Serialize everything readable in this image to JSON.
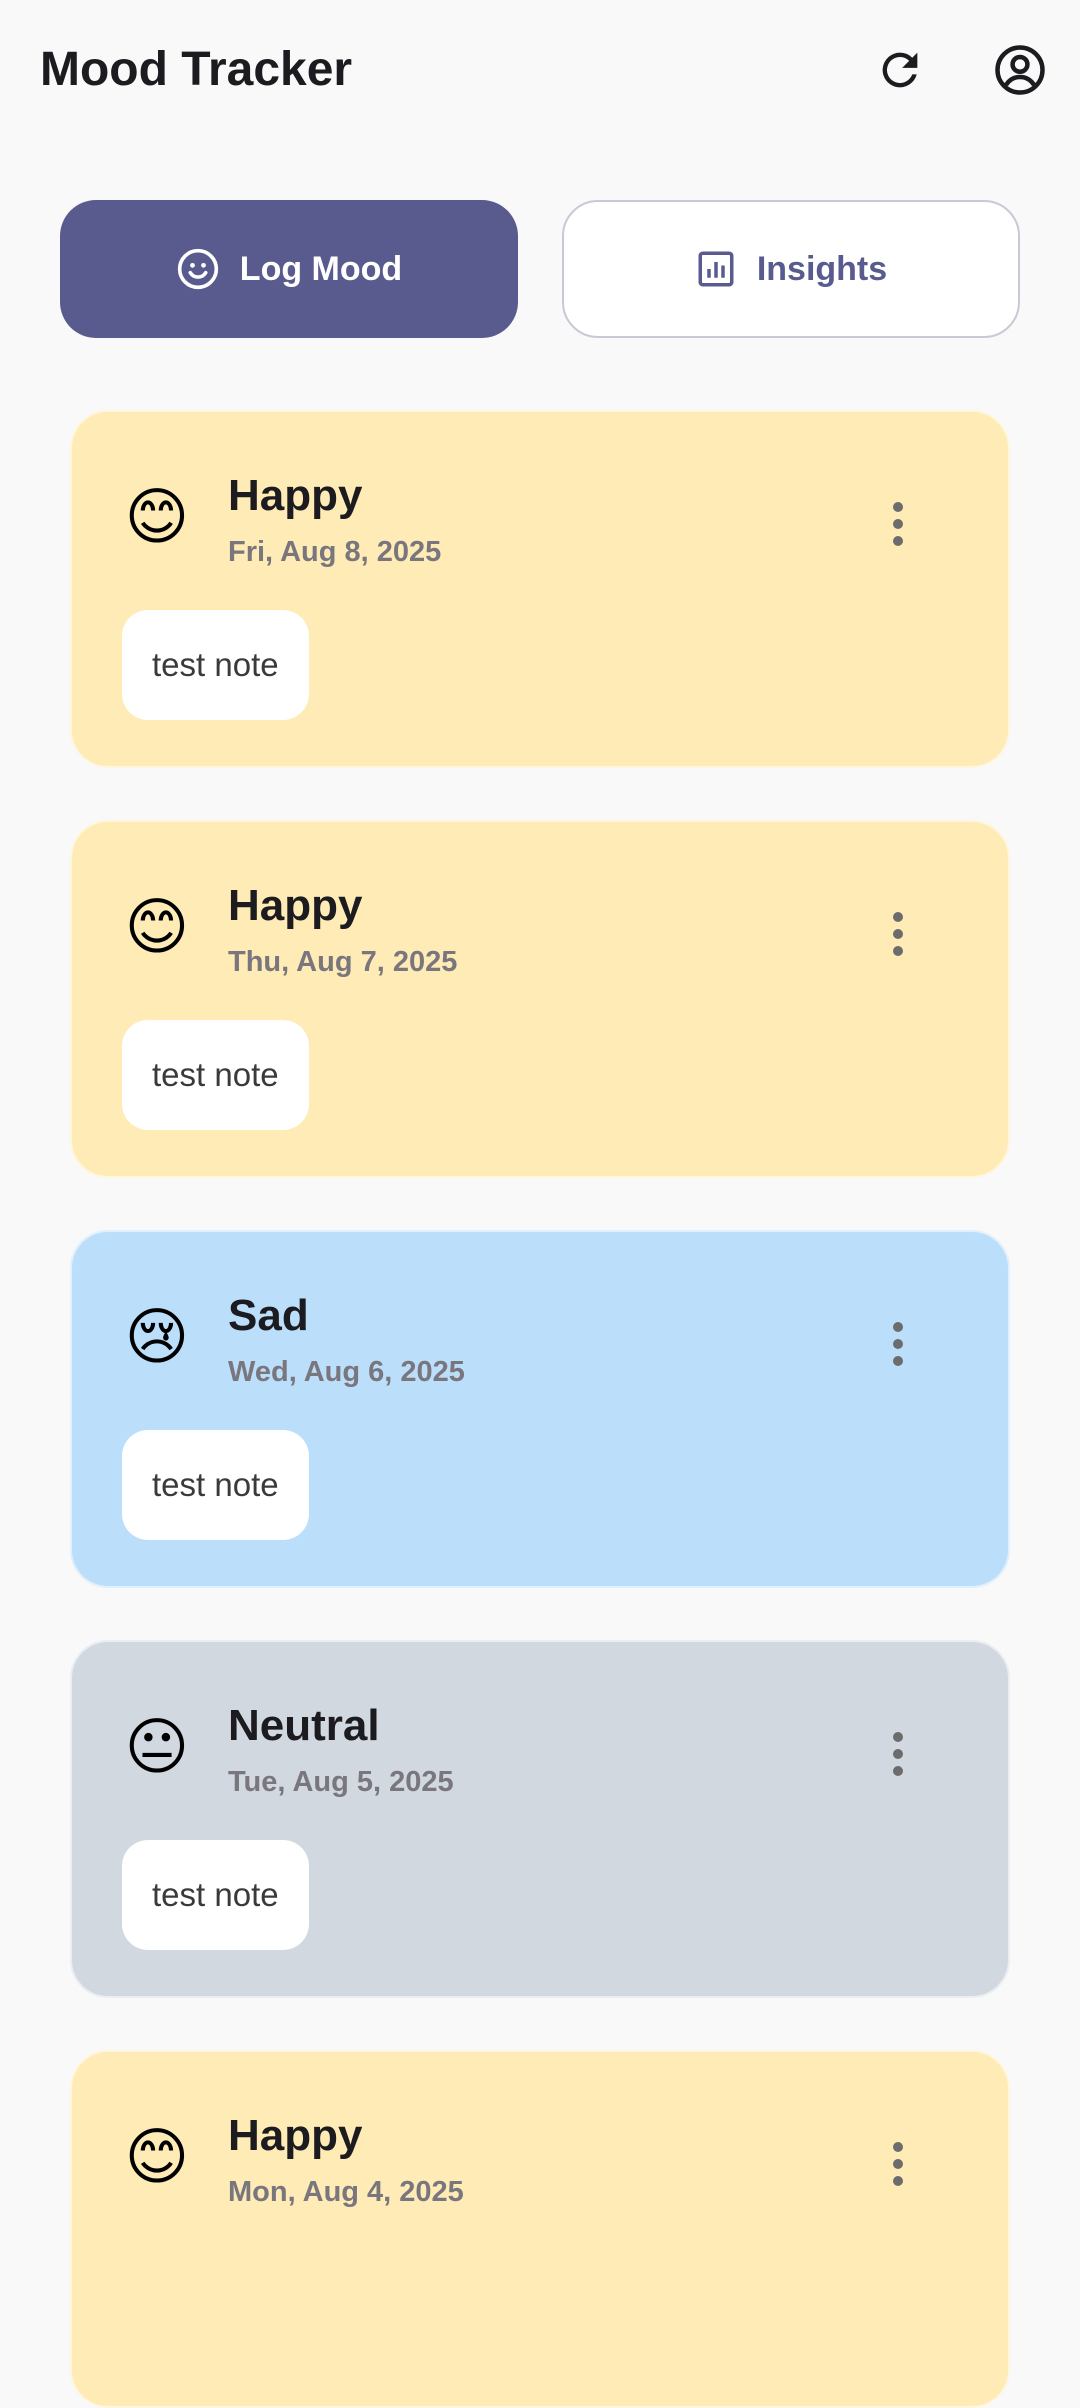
{
  "header": {
    "title": "Mood Tracker",
    "refresh_icon": "refresh-icon",
    "account_icon": "account-circle-icon"
  },
  "tabs": [
    {
      "label": "Log Mood",
      "icon": "smiley-face-icon",
      "active": true
    },
    {
      "label": "Insights",
      "icon": "bar-chart-icon",
      "active": false
    }
  ],
  "colors": {
    "primary": "#595b8f",
    "happy": "#feebb6",
    "sad": "#bbdefb",
    "neutral": "#d1d8df"
  },
  "entries": [
    {
      "emoji": "😊",
      "mood": "Happy",
      "date": "Fri, Aug 8, 2025",
      "note": "test note",
      "color": "#feebb6"
    },
    {
      "emoji": "😊",
      "mood": "Happy",
      "date": "Thu, Aug 7, 2025",
      "note": "test note",
      "color": "#feebb6"
    },
    {
      "emoji": "😢",
      "mood": "Sad",
      "date": "Wed, Aug 6, 2025",
      "note": "test note",
      "color": "#bbdefb"
    },
    {
      "emoji": "😐",
      "mood": "Neutral",
      "date": "Tue, Aug 5, 2025",
      "note": "test note",
      "color": "#d1d8df"
    },
    {
      "emoji": "😊",
      "mood": "Happy",
      "date": "Mon, Aug 4, 2025",
      "note": "",
      "color": "#feebb6"
    }
  ]
}
